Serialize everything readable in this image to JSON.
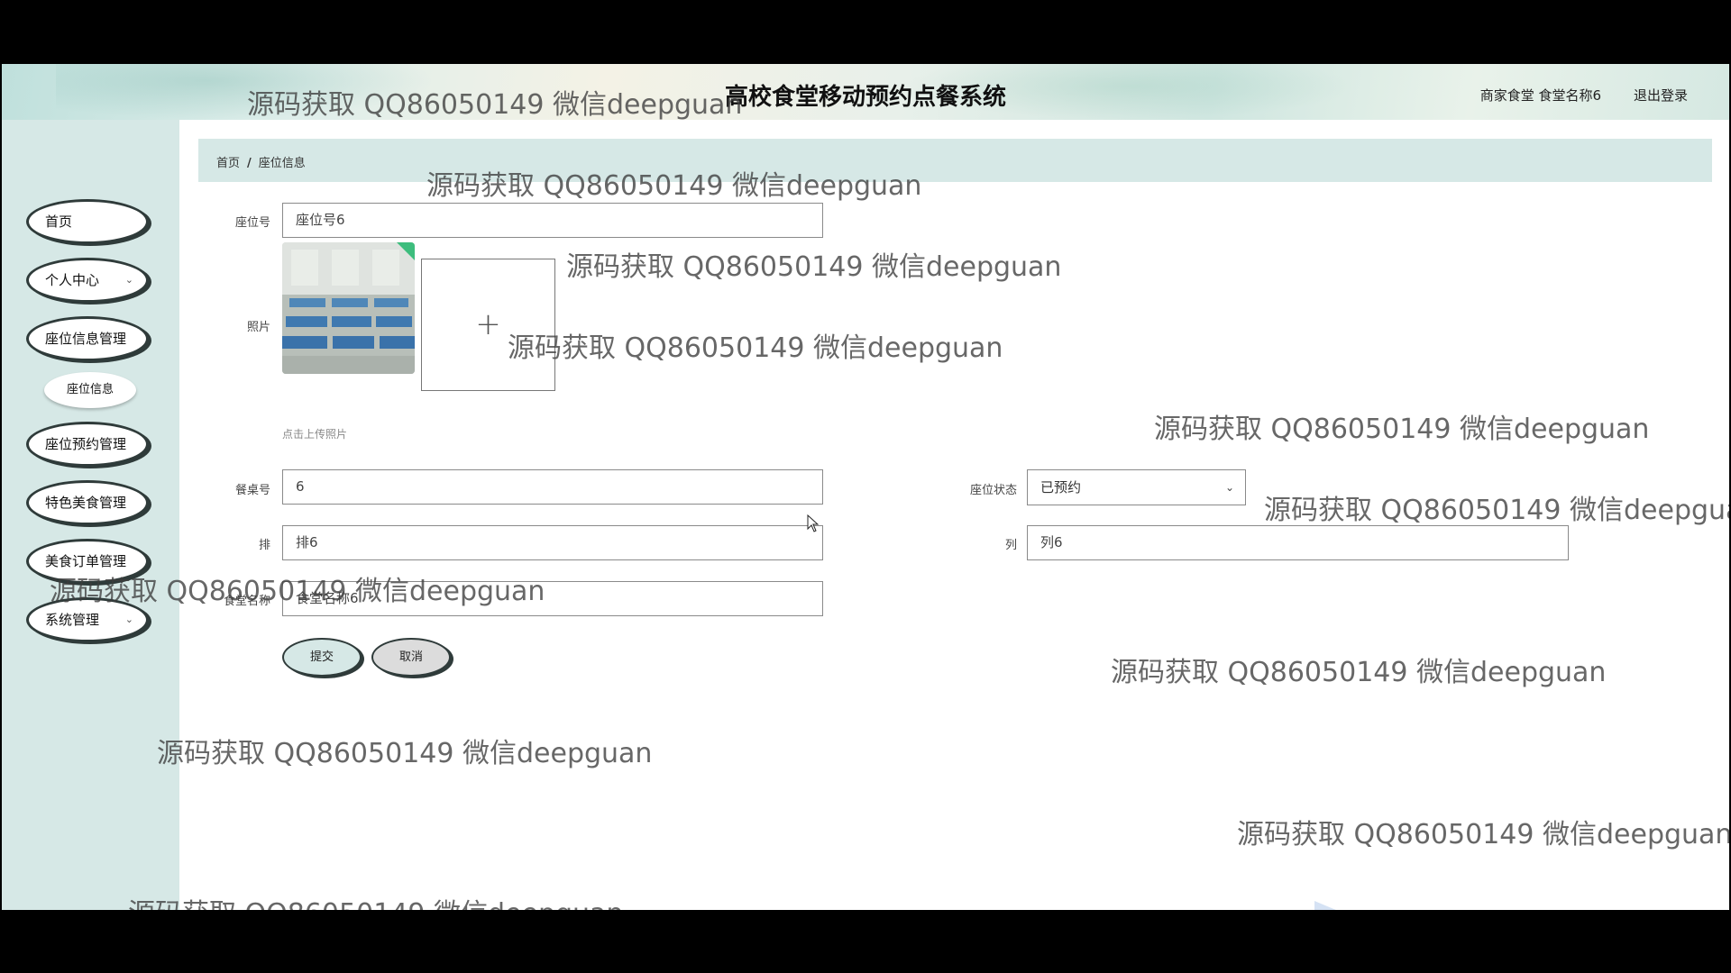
{
  "header": {
    "title": "高校食堂移动预约点餐系统",
    "user_info": "商家食堂 食堂名称6",
    "logout_label": "退出登录"
  },
  "sidebar": {
    "items": [
      {
        "label": "首页"
      },
      {
        "label": "个人中心"
      },
      {
        "label": "座位信息管理"
      },
      {
        "label": "座位信息"
      },
      {
        "label": "座位预约管理"
      },
      {
        "label": "特色美食管理"
      },
      {
        "label": "美食订单管理"
      },
      {
        "label": "系统管理"
      }
    ]
  },
  "breadcrumb": {
    "home": "首页",
    "separator": "/",
    "current": "座位信息"
  },
  "form": {
    "seat_no": {
      "label": "座位号",
      "value": "座位号6"
    },
    "photo": {
      "label": "照片",
      "upload_hint": "点击上传照片",
      "add_icon": "+"
    },
    "table_no": {
      "label": "餐桌号",
      "value": "6"
    },
    "seat_status": {
      "label": "座位状态",
      "value": "已预约"
    },
    "row": {
      "label": "排",
      "value": "排6"
    },
    "column": {
      "label": "列",
      "value": "列6"
    },
    "canteen_name": {
      "label": "食堂名称",
      "value": "食堂名称6"
    },
    "submit_label": "提交",
    "cancel_label": "取消"
  },
  "watermark": {
    "text": "源码获取 QQ86050149 微信deepguan"
  },
  "colors": {
    "sidebar_bg": "#d6e8e6",
    "breadcrumb_bg": "#d6e8e6",
    "button_border": "#2f3b3a"
  },
  "icons": {
    "chevron": "chevron-down-icon",
    "plus": "plus-icon",
    "cursor": "mouse-cursor-icon"
  }
}
